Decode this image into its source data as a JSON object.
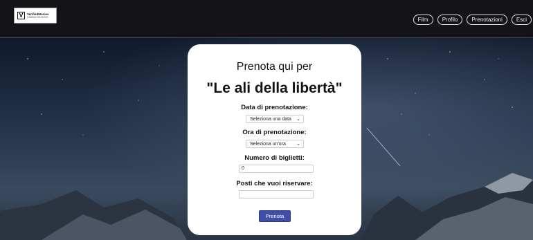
{
  "header": {
    "logo_mark": "V",
    "logo_name": "VerifiedMovies",
    "logo_tagline": "CINEMA BOOKING",
    "nav": [
      "Film",
      "Profilo",
      "Prenotazioni",
      "Esci"
    ]
  },
  "booking": {
    "title": "Prenota qui per",
    "movie": "\"Le ali della libertà\"",
    "date_label": "Data di prenotazione:",
    "date_value": "Seleziona una data",
    "time_label": "Ora di prenotazione:",
    "time_value": "Seleziona un'ora",
    "tickets_label": "Numero di biglietti:",
    "tickets_value": "0",
    "seats_label": "Posti che vuoi riservare:",
    "seats_value": "",
    "submit_label": "Prenota"
  },
  "colors": {
    "header_bg": "#141418",
    "button_bg": "#3f4fa8",
    "card_bg": "#ffffff"
  }
}
